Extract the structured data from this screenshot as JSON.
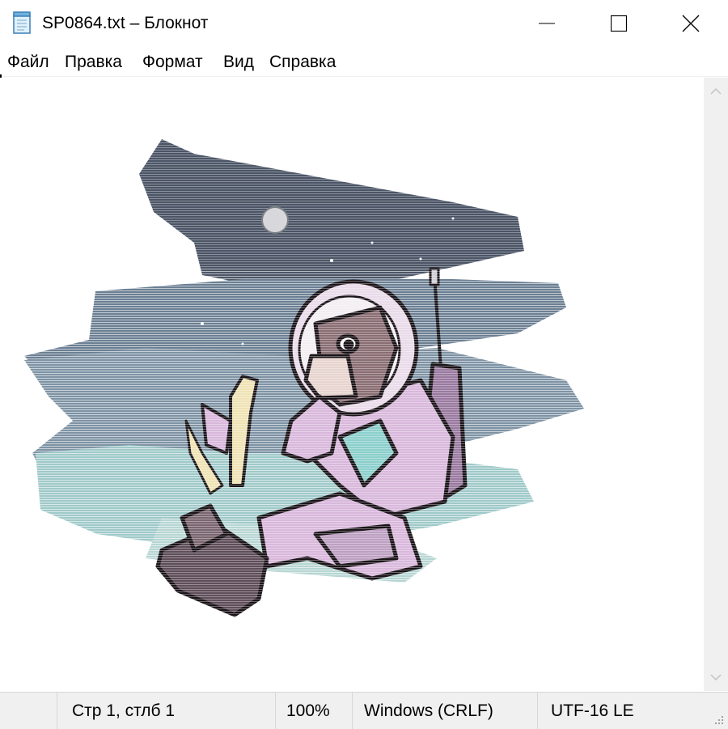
{
  "window": {
    "title": "SP0864.txt – Блокнот",
    "icon": "notepad-icon",
    "controls": [
      "minimize-icon",
      "maximize-icon",
      "close-icon"
    ]
  },
  "menu": {
    "file": "Файл",
    "edit": "Правка",
    "format": "Формат",
    "view": "Вид",
    "help": "Справка"
  },
  "editor": {
    "content_type": "ascii-art illustration: astronaut monkey in spacesuit holding a plant, night sky with moon and stars",
    "colors": {
      "sky_dark": "#4b5566",
      "sky_mid": "#6b7f93",
      "sky_teal": "#9fc9c9",
      "suit": "#d9b8dc",
      "suit_shade": "#9a7aa0",
      "boots": "#5f4e5a",
      "fur": "#8a6e73",
      "teal_trim": "#8ccfcc",
      "plant": "#efe3b5"
    }
  },
  "status": {
    "position": "Стр 1, стлб 1",
    "zoom": "100%",
    "line_endings": "Windows (CRLF)",
    "encoding": "UTF-16 LE"
  }
}
